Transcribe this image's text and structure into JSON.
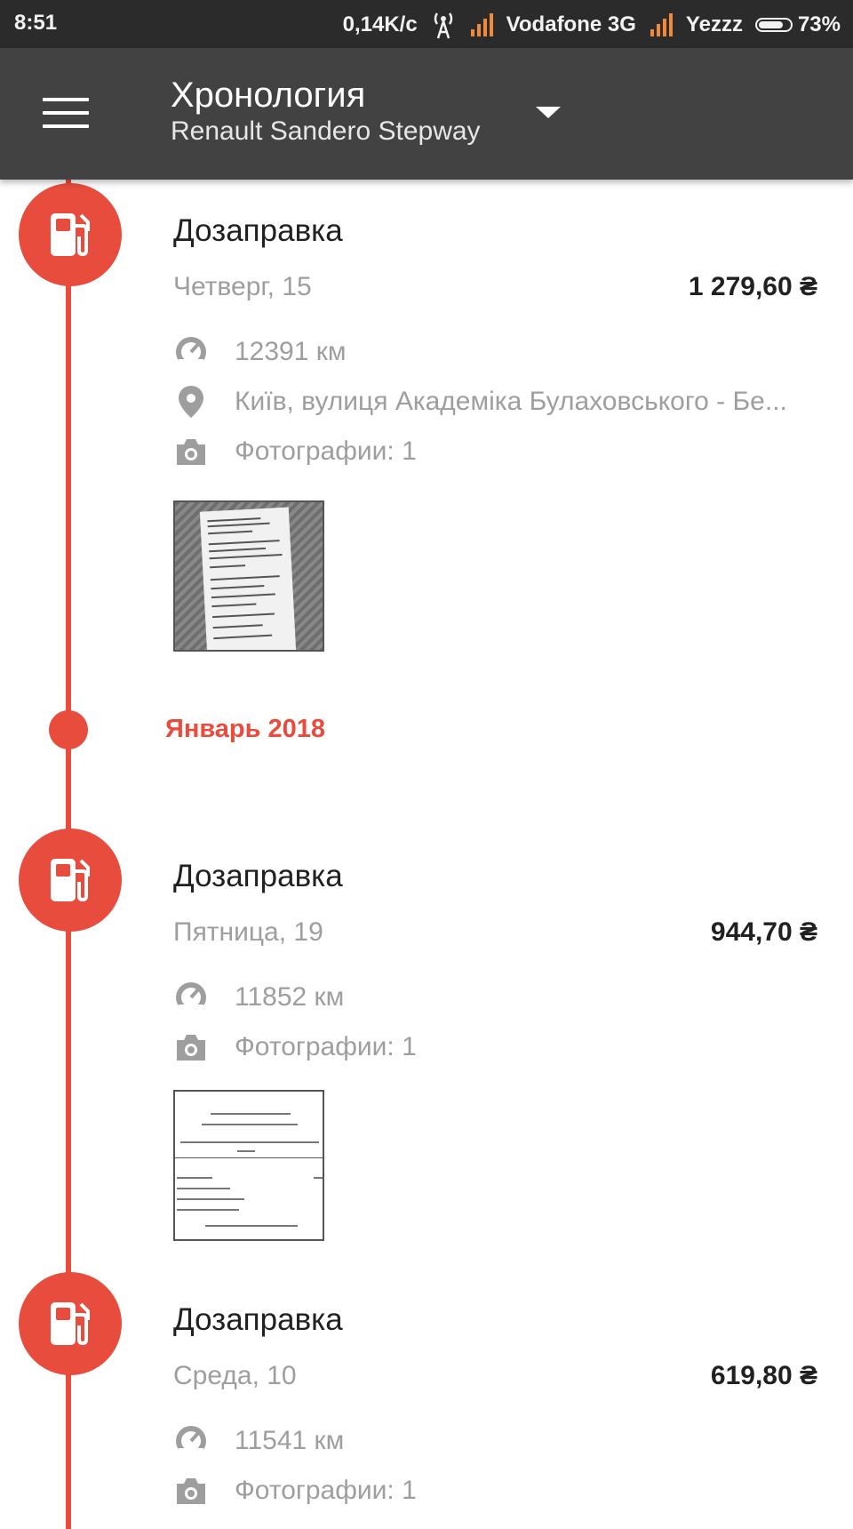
{
  "status_bar": {
    "time": "8:51",
    "speed": "0,14K/c",
    "carrier1": "Vodafone 3G",
    "carrier2": "Yezzz",
    "battery": "73%"
  },
  "toolbar": {
    "title": "Хронология",
    "subtitle": "Renault Sandero Stepway"
  },
  "timeline": {
    "month_label": "Январь 2018",
    "events": [
      {
        "title": "Дозаправка",
        "date": "Четверг, 15",
        "amount": "1 279,60 ₴",
        "odometer": "12391 км",
        "location": "Київ, вулиця Академіка Булаховського - Бе...",
        "photos": "Фотографии: 1"
      },
      {
        "title": "Дозаправка",
        "date": "Пятница, 19",
        "amount": "944,70 ₴",
        "odometer": "11852 км",
        "photos": "Фотографии: 1"
      },
      {
        "title": "Дозаправка",
        "date": "Среда, 10",
        "amount": "619,80 ₴",
        "odometer": "11541 км",
        "photos": "Фотографии: 1"
      }
    ]
  },
  "colors": {
    "accent": "#e84c3d",
    "toolbar": "#424242",
    "status_bar": "#2b2b2b",
    "secondary_text": "#9e9e9e"
  },
  "icons": [
    "menu-icon",
    "dropdown-icon",
    "fuel-pump-icon",
    "speedometer-icon",
    "location-pin-icon",
    "camera-icon",
    "wifi-tower-icon",
    "signal-icon",
    "battery-icon"
  ]
}
